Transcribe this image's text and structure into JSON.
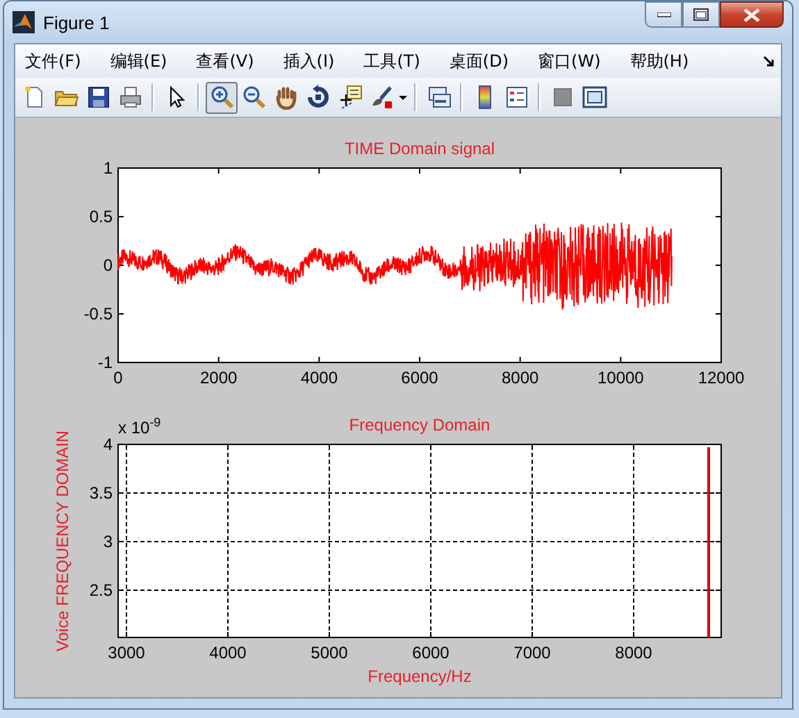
{
  "window": {
    "title": "Figure 1"
  },
  "menu": [
    "文件(F)",
    "编辑(E)",
    "查看(V)",
    "插入(I)",
    "工具(T)",
    "桌面(D)",
    "窗口(W)",
    "帮助(H)"
  ],
  "toolbar": {
    "groups": [
      [
        {
          "selected": false
        },
        {
          "selected": false
        },
        {
          "selected": false
        },
        {
          "selected": false
        }
      ],
      [
        {
          "selected": false
        }
      ],
      [
        {
          "selected": true
        },
        {
          "selected": false
        },
        {
          "selected": false
        },
        {
          "selected": false
        },
        {
          "selected": false
        },
        {
          "selected": false
        }
      ],
      [
        {
          "selected": false
        }
      ],
      [
        {
          "selected": false
        },
        {
          "selected": false
        }
      ],
      [
        {
          "selected": false
        },
        {
          "selected": false
        }
      ]
    ]
  },
  "axes": [
    {
      "title": "TIME Domain signal",
      "xticks": [
        "0",
        "2000",
        "4000",
        "6000",
        "8000",
        "10000",
        "12000"
      ],
      "yticks": [
        "1",
        "0.5",
        "0",
        "-0.5",
        "-1"
      ]
    },
    {
      "title": "Frequency Domain",
      "exponent": "x 10$^{-9}$",
      "xticks": [
        "3000",
        "4000",
        "5000",
        "6000",
        "7000",
        "8000"
      ],
      "yticks": [
        "4",
        "3.5",
        "3",
        "2.5"
      ],
      "xlabel": "Frequency/Hz",
      "ylabel": "Voice FREQUENCY DOMAIN",
      "grid": true
    }
  ]
}
